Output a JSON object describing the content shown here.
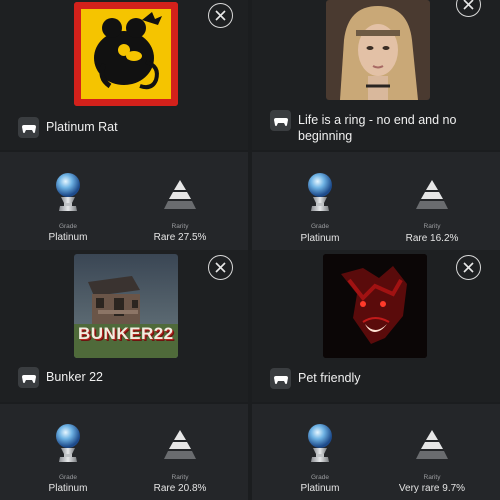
{
  "cards": [
    {
      "title": "Platinum Rat",
      "thumbnail_icon": "rat-logo-icon",
      "grade_label": "Grade",
      "grade_value": "Platinum",
      "rarity_label": "Rarity",
      "rarity_value": "Rare 27.5%"
    },
    {
      "title": "Life is a ring - no end and no beginning",
      "thumbnail_icon": "blonde-woman-portrait",
      "grade_label": "Grade",
      "grade_value": "Platinum",
      "rarity_label": "Rarity",
      "rarity_value": "Rare 16.2%"
    },
    {
      "title": "Bunker 22",
      "thumbnail_icon": "cabin-house-artwork",
      "thumbnail_text": "BUNKER22",
      "grade_label": "Grade",
      "grade_value": "Platinum",
      "rarity_label": "Rarity",
      "rarity_value": "Rare 20.8%"
    },
    {
      "title": "Pet friendly",
      "thumbnail_icon": "red-wolf-artwork",
      "grade_label": "Grade",
      "grade_value": "Platinum",
      "rarity_label": "Rarity",
      "rarity_value": "Very rare 9.7%"
    }
  ],
  "colors": {
    "background": "#1b1d1f",
    "card_bottom": "#242629",
    "rat_yellow": "#f5c400",
    "rat_red": "#d3211b"
  }
}
